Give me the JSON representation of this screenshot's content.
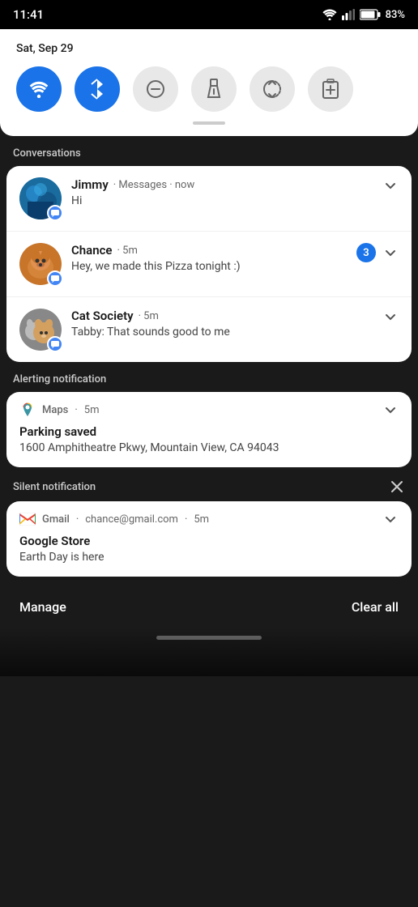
{
  "statusBar": {
    "time": "11:41",
    "battery": "83%"
  },
  "quickSettings": {
    "date": "Sat, Sep 29",
    "icons": [
      {
        "id": "wifi",
        "active": true,
        "label": "Wi-Fi"
      },
      {
        "id": "bluetooth",
        "active": true,
        "label": "Bluetooth"
      },
      {
        "id": "dnd",
        "active": false,
        "label": "Do Not Disturb"
      },
      {
        "id": "flashlight",
        "active": false,
        "label": "Flashlight"
      },
      {
        "id": "autorotate",
        "active": false,
        "label": "Auto Rotate"
      },
      {
        "id": "battery",
        "active": false,
        "label": "Battery Saver"
      }
    ]
  },
  "conversations": {
    "sectionLabel": "Conversations",
    "items": [
      {
        "name": "Jimmy",
        "app": "Messages",
        "time": "now",
        "message": "Hi",
        "unreadCount": null,
        "avatarType": "jimmy"
      },
      {
        "name": "Chance",
        "app": "",
        "time": "5m",
        "message": "Hey, we made this Pizza tonight :)",
        "unreadCount": 3,
        "avatarType": "chance"
      },
      {
        "name": "Cat Society",
        "app": "",
        "time": "5m",
        "message": "Tabby: That sounds good to me",
        "unreadCount": null,
        "avatarType": "catsociety"
      }
    ]
  },
  "alerting": {
    "sectionLabel": "Alerting notification",
    "app": "Maps",
    "time": "5m",
    "title": "Parking saved",
    "body": "1600 Amphitheatre Pkwy, Mountain View, CA 94043"
  },
  "silent": {
    "sectionLabel": "Silent notification",
    "app": "Gmail",
    "sender": "chance@gmail.com",
    "time": "5m",
    "title": "Google Store",
    "body": "Earth Day is here"
  },
  "footer": {
    "manage": "Manage",
    "clearAll": "Clear all"
  }
}
